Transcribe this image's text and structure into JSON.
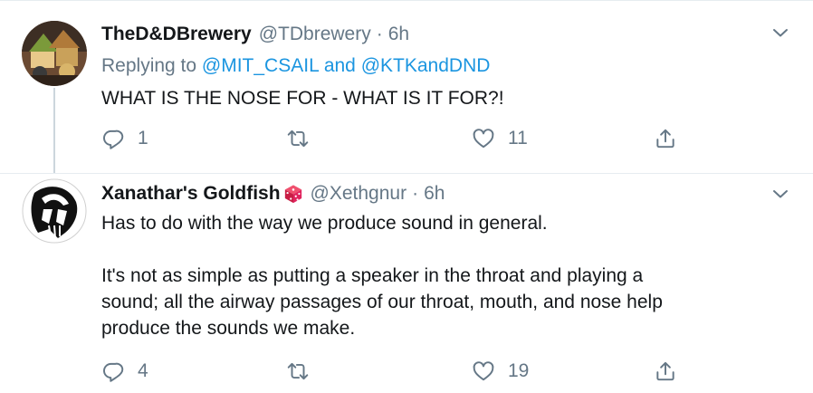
{
  "tweets": [
    {
      "display_name": "TheD&DBrewery",
      "handle": "@TDbrewery",
      "separator": "·",
      "time": "6h",
      "replying_prefix": "Replying to",
      "replying_user1": "@MIT_CSAIL",
      "replying_and": "and",
      "replying_user2": "@KTKandDND",
      "text_lines": [
        "WHAT IS THE NOSE FOR - WHAT IS IT FOR?!"
      ],
      "reply_count": "1",
      "retweet_count": "",
      "like_count": "11",
      "icons": [
        "reply-icon",
        "retweet-icon",
        "like-icon",
        "share-icon",
        "chevron-down-icon"
      ]
    },
    {
      "display_name": "Xanathar's Goldfish",
      "handle": "@Xethgnur",
      "separator": "·",
      "time": "6h",
      "text_lines": [
        "Has to do with the way we produce sound in general.",
        "It's not as simple as putting a speaker in the throat and playing a",
        "sound; all the airway passages of our throat, mouth, and nose help",
        "produce the sounds we make."
      ],
      "reply_count": "4",
      "retweet_count": "",
      "like_count": "19",
      "name_emoji": "dice-icon",
      "icons": [
        "reply-icon",
        "retweet-icon",
        "like-icon",
        "share-icon",
        "chevron-down-icon"
      ]
    }
  ],
  "colors": {
    "text": "#14171a",
    "secondary": "#657786",
    "link": "#1b95e0",
    "border": "#e6ecf0",
    "dice": "#e0245e"
  }
}
